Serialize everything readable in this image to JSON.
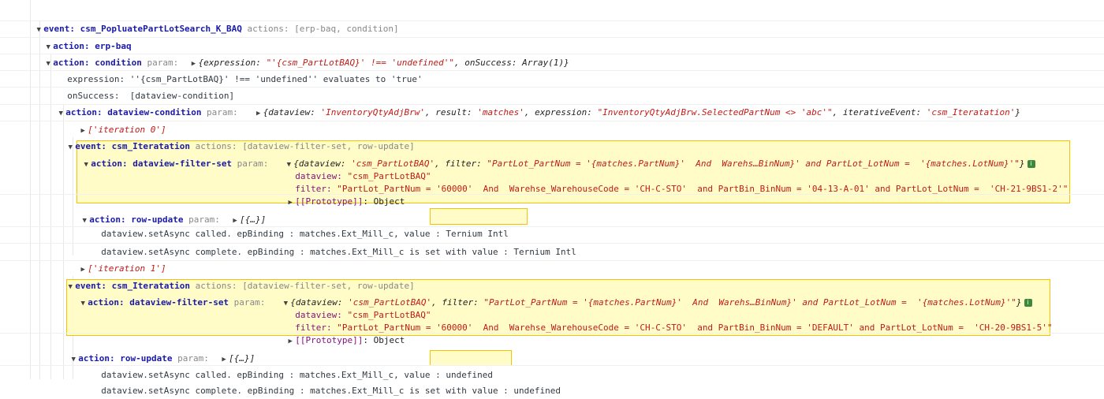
{
  "event_main": {
    "prefix": "event: ",
    "name": "csm_PopluatePartLotSearch_K_BAQ",
    "actions_label": " actions: ",
    "actions": "[erp-baq, condition]"
  },
  "action_erp": "action: erp-baq",
  "action_condition": {
    "label": "action: condition",
    "param": " param: ",
    "summary_open": "{",
    "k1": "expression: ",
    "v1": "\"'{csm_PartLotBAQ}' !== 'undefined'\"",
    "sep1": ", ",
    "k2": "onSuccess: ",
    "v2": "Array(1)",
    "close": "}"
  },
  "expression_line": "expression: ''{csm_PartLotBAQ}' !== 'undefined'' evaluates to 'true'",
  "onsuccess_line": "onSuccess:  [dataview-condition]",
  "dataview_condition": {
    "label": "action: dataview-condition",
    "param": " param: ",
    "open": "{",
    "k1": "dataview: ",
    "v1": "'InventoryQtyAdjBrw'",
    "k2": "result: ",
    "v2": "'matches'",
    "k3": "expression: ",
    "v3": "\"InventoryQtyAdjBrw.SelectedPartNum <> 'abc'\"",
    "k4": "iterativeEvent: ",
    "v4": "'csm_Iteratation'",
    "close": "}"
  },
  "iteration0": "['iteration 0']",
  "iteration1": "['iteration 1']",
  "iter_event": {
    "prefix": "event: ",
    "name": "csm_Iteratation",
    "actions_label": " actions: ",
    "actions": "[dataview-filter-set, row-update]"
  },
  "filter_set_1": {
    "label": "action: dataview-filter-set",
    "param": " param: ",
    "summary_open": "{",
    "k1": "dataview: ",
    "v1": "'csm_PartLotBAQ'",
    "k2": "filter: ",
    "v2": "\"PartLot_PartNum = '{matches.PartNum}'  And  Warehs…BinNum}' and PartLot_LotNum =  '{matches.LotNum}'\"",
    "close": "}",
    "dataview_key": "dataview: ",
    "dataview_val": "\"csm_PartLotBAQ\"",
    "filter_key": "filter: ",
    "filter_val": "\"PartLot_PartNum = '60000'  And  Warehse_WarehouseCode = 'CH-C-STO'  and PartBin_BinNum = '04-13-A-01' and PartLot_LotNum =  'CH-21-9BS1-2'\"",
    "proto_key": "[[Prototype]]",
    "proto_val": ": Object"
  },
  "row_update": {
    "label": "action: row-update",
    "param": " param: ",
    "val": "[{…}]"
  },
  "async_called_1": {
    "text": "dataview.setAsync called. epBinding : matches.Ext_Mill_c, value : ",
    "value": "Ternium Intl"
  },
  "async_complete_1": "dataview.setAsync complete. epBinding : matches.Ext_Mill_c is set with value : Ternium Intl",
  "filter_set_2": {
    "label": "action: dataview-filter-set",
    "param": " param: ",
    "summary_open": "{",
    "k1": "dataview: ",
    "v1": "'csm_PartLotBAQ'",
    "k2": "filter: ",
    "v2": "\"PartLot_PartNum = '{matches.PartNum}'  And  Warehs…BinNum}' and PartLot_LotNum =  '{matches.LotNum}'\"",
    "close": "}",
    "dataview_key": "dataview: ",
    "dataview_val": "\"csm_PartLotBAQ\"",
    "filter_key": "filter: ",
    "filter_val": "\"PartLot_PartNum = '60000'  And  Warehse_WarehouseCode = 'CH-C-STO'  and PartBin_BinNum = 'DEFAULT' and PartLot_LotNum =  'CH-20-9BS1-5'\"",
    "proto_key": "[[Prototype]]",
    "proto_val": ": Object"
  },
  "async_called_2": {
    "text": "dataview.setAsync called. epBinding : matches.Ext_Mill_c, value : ",
    "value": "undefined"
  },
  "async_complete_2": "dataview.setAsync complete. epBinding : matches.Ext_Mill_c is set with value : undefined",
  "info_icon": "i"
}
